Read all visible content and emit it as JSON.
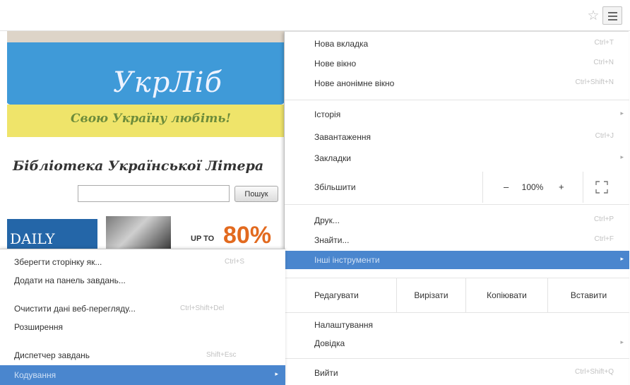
{
  "toolbar": {
    "bookmark_icon": "star-outline-icon",
    "star_glyph": "☆",
    "menu_icon": "hamburger-menu-icon"
  },
  "page": {
    "logo": "УкрЛіб",
    "slogan": "Свою Україну любіть!",
    "title": "Бібліотека Української Літера",
    "search_button": "Пошук",
    "ad_daily": "DAILY",
    "ad_upto": "UP TO",
    "ad_percent": "80%"
  },
  "menu": {
    "new_tab": {
      "label": "Нова вкладка",
      "shortcut": "Ctrl+T"
    },
    "new_window": {
      "label": "Нове вікно",
      "shortcut": "Ctrl+N"
    },
    "incognito": {
      "label": "Нове анонімне вікно",
      "shortcut": "Ctrl+Shift+N"
    },
    "history": {
      "label": "Історія"
    },
    "downloads": {
      "label": "Завантаження",
      "shortcut": "Ctrl+J"
    },
    "bookmarks": {
      "label": "Закладки"
    },
    "zoom": {
      "label": "Збільшити",
      "minus": "–",
      "value": "100%",
      "plus": "+"
    },
    "print": {
      "label": "Друк...",
      "shortcut": "Ctrl+P"
    },
    "find": {
      "label": "Знайти...",
      "shortcut": "Ctrl+F"
    },
    "more_tools": {
      "label": "Інші інструменти"
    },
    "edit": {
      "label": "Редагувати",
      "cut": "Вирізати",
      "copy": "Копіювати",
      "paste": "Вставити"
    },
    "settings": {
      "label": "Налаштування"
    },
    "help": {
      "label": "Довідка"
    },
    "exit": {
      "label": "Вийти",
      "shortcut": "Ctrl+Shift+Q"
    },
    "arrow": "▸"
  },
  "submenu": {
    "save_page": {
      "label": "Зберегти сторінку як...",
      "shortcut": "Ctrl+S"
    },
    "add_to_taskbar": {
      "label": "Додати на панель завдань..."
    },
    "clear_data": {
      "label": "Очистити дані веб-перегляду...",
      "shortcut": "Ctrl+Shift+Del"
    },
    "extensions": {
      "label": "Розширення"
    },
    "task_manager": {
      "label": "Диспетчер завдань",
      "shortcut": "Shift+Esc"
    },
    "encoding": {
      "label": "Кодування"
    },
    "arrow": "▸"
  },
  "colors": {
    "highlight": "#4a86ce",
    "banner_blue": "#3f9ad8",
    "banner_yellow": "#efe46a",
    "ad_orange": "#e26a1f"
  }
}
